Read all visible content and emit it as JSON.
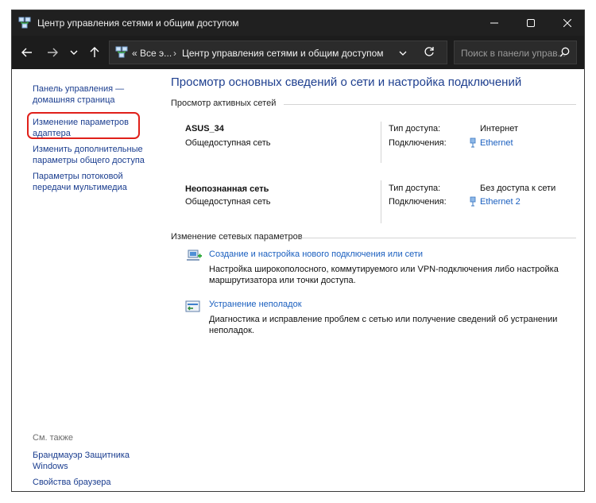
{
  "window": {
    "title": "Центр управления сетями и общим доступом",
    "buttons": {
      "minimize": "minimize",
      "maximize": "maximize",
      "close": "close"
    }
  },
  "address_bar": {
    "segment1": "Все э...",
    "segment0": "«",
    "separator": "›",
    "segment2": "Центр управления сетями и общим доступом",
    "search_placeholder": "Поиск в панели управ..."
  },
  "sidebar": {
    "items": [
      {
        "label1": "Панель управления —",
        "label2": "домашняя страница"
      },
      {
        "label1": "Изменение параметров",
        "label2": "адаптера"
      },
      {
        "label1": "Изменить дополнительные",
        "label2": "параметры общего доступа"
      },
      {
        "label1": "Параметры потоковой",
        "label2": "передачи мультимедиа"
      }
    ],
    "see_also_title": "См. также",
    "see_also": [
      {
        "label1": "Брандмауэр Защитника",
        "label2": "Windows"
      },
      {
        "label1": "Свойства браузера"
      }
    ]
  },
  "main": {
    "title": "Просмотр основных сведений о сети и настройка подключений",
    "active_networks_header": "Просмотр активных сетей",
    "networks": [
      {
        "name": "ASUS_34",
        "type": "Общедоступная сеть",
        "access_label": "Тип доступа:",
        "access_value": "Интернет",
        "conn_label": "Подключения:",
        "conn_value": "Ethernet"
      },
      {
        "name": "Неопознанная сеть",
        "type": "Общедоступная сеть",
        "access_label": "Тип доступа:",
        "access_value": "Без доступа к сети",
        "conn_label": "Подключения:",
        "conn_value": "Ethernet 2"
      }
    ],
    "change_header": "Изменение сетевых параметров",
    "tasks": [
      {
        "link": "Создание и настройка нового подключения или сети",
        "desc": "Настройка широкополосного, коммутируемого или VPN-подключения либо настройка маршрутизатора или точки доступа."
      },
      {
        "link": "Устранение неполадок",
        "desc": "Диагностика и исправление проблем с сетью или получение сведений об устранении неполадок."
      }
    ]
  },
  "colors": {
    "titlebar": "#202020",
    "link": "#1a5fbf",
    "heading": "#1e3f8f",
    "highlight": "#e0201a"
  }
}
